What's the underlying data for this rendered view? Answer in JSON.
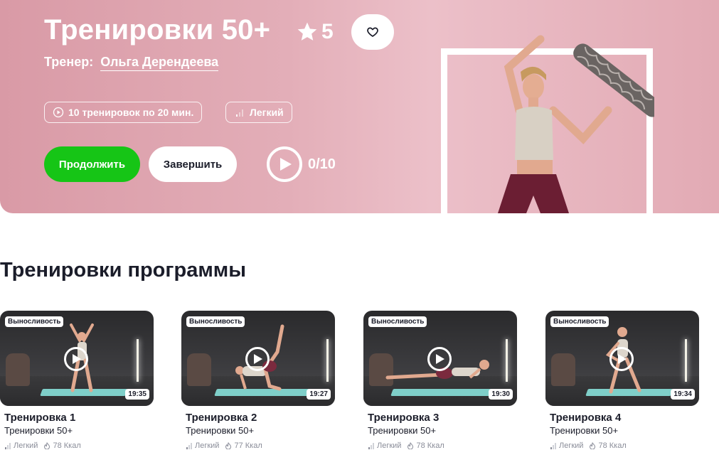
{
  "hero": {
    "title": "Тренировки 50+",
    "rating": "5",
    "trainer_label": "Тренер:",
    "trainer_name": "Ольга Дерендеева",
    "chips": [
      "10 тренировок по 20 мин.",
      "Легкий"
    ],
    "continue_label": "Продолжить",
    "finish_label": "Завершить",
    "progress": "0/10"
  },
  "section": {
    "title": "Тренировки программы"
  },
  "workouts": [
    {
      "badge": "Выносливость",
      "duration": "19:35",
      "title": "Тренировка 1",
      "program": "Тренировки 50+",
      "level": "Легкий",
      "kcal": "78 Ккал"
    },
    {
      "badge": "Выносливость",
      "duration": "19:27",
      "title": "Тренировка 2",
      "program": "Тренировки 50+",
      "level": "Легкий",
      "kcal": "77 Ккал"
    },
    {
      "badge": "Выносливость",
      "duration": "19:30",
      "title": "Тренировка 3",
      "program": "Тренировки 50+",
      "level": "Легкий",
      "kcal": "78 Ккал"
    },
    {
      "badge": "Выносливость",
      "duration": "19:34",
      "title": "Тренировка 4",
      "program": "Тренировки 50+",
      "level": "Легкий",
      "kcal": "78 Ккал"
    }
  ],
  "colors": {
    "hero": "#e3aeb8",
    "accent_green": "#16c516",
    "text": "#1b1d2a",
    "muted": "#8a8d99"
  },
  "icons": [
    "star-icon",
    "heart-icon",
    "play-circle-icon",
    "level-bars-icon",
    "play-icon",
    "flame-icon"
  ]
}
